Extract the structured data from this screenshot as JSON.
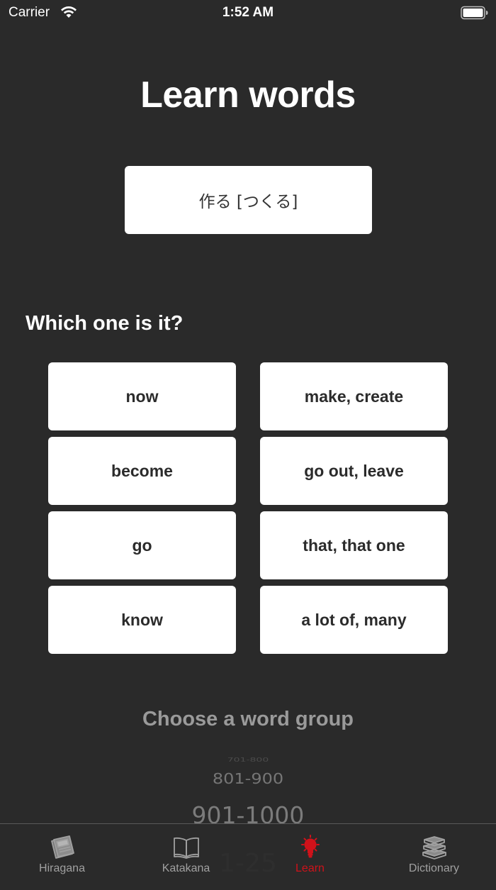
{
  "status_bar": {
    "carrier": "Carrier",
    "time": "1:52 AM"
  },
  "title": "Learn words",
  "word": "作る [つくる]",
  "question": "Which one is it?",
  "answers": [
    "now",
    "make, create",
    "become",
    "go out, leave",
    "go",
    "that, that one",
    "know",
    "a lot of, many"
  ],
  "group_picker": {
    "title": "Choose a word group",
    "items": [
      "701-800",
      "801-900",
      "901-1000",
      "1-25"
    ]
  },
  "tab_bar": {
    "tabs": [
      {
        "label": "Hiragana",
        "icon": "newspaper-icon"
      },
      {
        "label": "Katakana",
        "icon": "book-icon"
      },
      {
        "label": "Learn",
        "icon": "lightbulb-icon"
      },
      {
        "label": "Dictionary",
        "icon": "books-stack-icon"
      }
    ],
    "active_color": "#d0121a"
  }
}
